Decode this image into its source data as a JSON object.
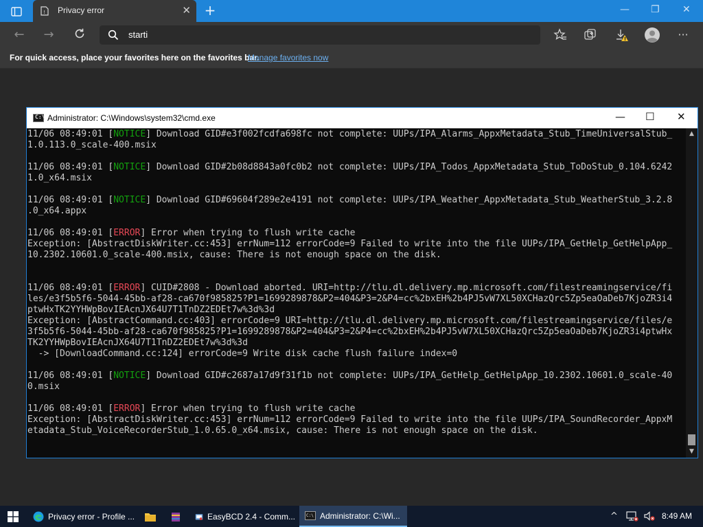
{
  "browser": {
    "tab_title": "Privacy error",
    "tab_close": "✕",
    "new_tab": "+",
    "address_text": "starti",
    "favbar_text": "For quick access, place your favorites here on the favorites bar.",
    "favbar_link": "Manage favorites now",
    "window_controls": {
      "minimize": "—",
      "restore": "❐",
      "close": "✕"
    }
  },
  "cmd": {
    "title": "Administrator: C:\\Windows\\system32\\cmd.exe",
    "icon_text": "C:\\",
    "controls": {
      "minimize": "—",
      "maximize": "☐",
      "close": "✕"
    },
    "lines": [
      {
        "prefix": "11/06 08:49:01 [",
        "tag": "NOTICE",
        "tagClass": "tag-notice",
        "rest": "] Download GID#e3f002fcdfa698fc not complete: UUPs/IPA_Alarms_AppxMetadata_Stub_TimeUniversalStub_"
      },
      {
        "text": "1.0.113.0_scale-400.msix"
      },
      {
        "text": ""
      },
      {
        "prefix": "11/06 08:49:01 [",
        "tag": "NOTICE",
        "tagClass": "tag-notice",
        "rest": "] Download GID#2b08d8843a0fc0b2 not complete: UUPs/IPA_Todos_AppxMetadata_Stub_ToDoStub_0.104.6242"
      },
      {
        "text": "1.0_x64.msix"
      },
      {
        "text": ""
      },
      {
        "prefix": "11/06 08:49:01 [",
        "tag": "NOTICE",
        "tagClass": "tag-notice",
        "rest": "] Download GID#69604f289e2e4191 not complete: UUPs/IPA_Weather_AppxMetadata_Stub_WeatherStub_3.2.8"
      },
      {
        "text": ".0_x64.appx"
      },
      {
        "text": ""
      },
      {
        "prefix": "11/06 08:49:01 [",
        "tag": "ERROR",
        "tagClass": "tag-error",
        "rest": "] Error when trying to flush write cache"
      },
      {
        "text": "Exception: [AbstractDiskWriter.cc:453] errNum=112 errorCode=9 Failed to write into the file UUPs/IPA_GetHelp_GetHelpApp_"
      },
      {
        "text": "10.2302.10601.0_scale-400.msix, cause: There is not enough space on the disk."
      },
      {
        "text": ""
      },
      {
        "text": ""
      },
      {
        "prefix": "11/06 08:49:01 [",
        "tag": "ERROR",
        "tagClass": "tag-error",
        "rest": "] CUID#2808 - Download aborted. URI=http://tlu.dl.delivery.mp.microsoft.com/filestreamingservice/fi"
      },
      {
        "text": "les/e3f5b5f6-5044-45bb-af28-ca670f985825?P1=1699289878&P2=404&P3=2&P4=cc%2bxEH%2b4PJ5vW7XL50XCHazQrc5Zp5eaOaDeb7KjoZR3i4"
      },
      {
        "text": "ptwHxTK2YYHWpBovIEAcnJX64U7T1TnDZ2EDEt7w%3d%3d"
      },
      {
        "text": "Exception: [AbstractCommand.cc:403] errorCode=9 URI=http://tlu.dl.delivery.mp.microsoft.com/filestreamingservice/files/e"
      },
      {
        "text": "3f5b5f6-5044-45bb-af28-ca670f985825?P1=1699289878&P2=404&P3=2&P4=cc%2bxEH%2b4PJ5vW7XL50XCHazQrc5Zp5eaOaDeb7KjoZR3i4ptwHx"
      },
      {
        "text": "TK2YYHWpBovIEAcnJX64U7T1TnDZ2EDEt7w%3d%3d"
      },
      {
        "text": "  -> [DownloadCommand.cc:124] errorCode=9 Write disk cache flush failure index=0"
      },
      {
        "text": ""
      },
      {
        "prefix": "11/06 08:49:01 [",
        "tag": "NOTICE",
        "tagClass": "tag-notice",
        "rest": "] Download GID#c2687a17d9f31f1b not complete: UUPs/IPA_GetHelp_GetHelpApp_10.2302.10601.0_scale-40"
      },
      {
        "text": "0.msix"
      },
      {
        "text": ""
      },
      {
        "prefix": "11/06 08:49:01 [",
        "tag": "ERROR",
        "tagClass": "tag-error",
        "rest": "] Error when trying to flush write cache"
      },
      {
        "text": "Exception: [AbstractDiskWriter.cc:453] errNum=112 errorCode=9 Failed to write into the file UUPs/IPA_SoundRecorder_AppxM"
      },
      {
        "text": "etadata_Stub_VoiceRecorderStub_1.0.65.0_x64.msix, cause: There is not enough space on the disk."
      }
    ]
  },
  "taskbar": {
    "items": [
      {
        "label": "Privacy error - Profile ...",
        "icon": "edge-icon"
      },
      {
        "label": "",
        "icon": "file-explorer-icon"
      },
      {
        "label": "",
        "icon": "winrar-icon"
      },
      {
        "label": "EasyBCD 2.4 - Comm...",
        "icon": "easybcd-icon"
      },
      {
        "label": "Administrator: C:\\Wi...",
        "icon": "cmd-icon"
      }
    ],
    "clock": "8:49 AM"
  },
  "colors": {
    "accent": "#1f85d9",
    "notice": "#13a10e",
    "error": "#e74856",
    "console_bg": "#0c0c0c",
    "console_fg": "#cccccc"
  }
}
